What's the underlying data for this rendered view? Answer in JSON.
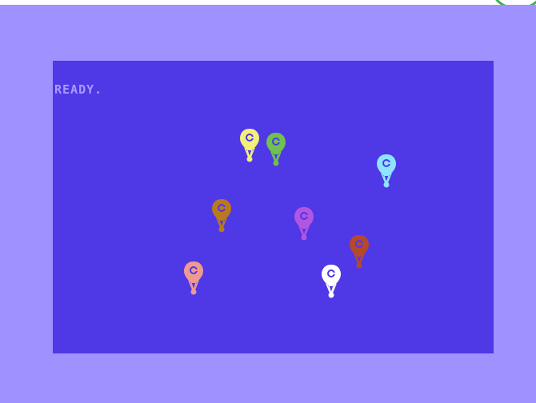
{
  "screen": {
    "status_text": "READY."
  },
  "colors": {
    "outer_border": "#9f91ff",
    "screen_background": "#4f38e6",
    "text": "#a99bff",
    "emblem_ring": "#3fae54"
  },
  "sprites": [
    {
      "name": "balloon-yellow",
      "color": "#f2f07a",
      "icon": "balloon-icon"
    },
    {
      "name": "balloon-green",
      "color": "#6fc24e",
      "icon": "balloon-icon"
    },
    {
      "name": "balloon-cyan",
      "color": "#8ee4ff",
      "icon": "balloon-icon"
    },
    {
      "name": "balloon-orange",
      "color": "#b9791d",
      "icon": "balloon-icon"
    },
    {
      "name": "balloon-purple",
      "color": "#b255e0",
      "icon": "balloon-icon"
    },
    {
      "name": "balloon-rust",
      "color": "#b4492d",
      "icon": "balloon-icon"
    },
    {
      "name": "balloon-salmon",
      "color": "#f09a8f",
      "icon": "balloon-icon"
    },
    {
      "name": "balloon-white",
      "color": "#ffffff",
      "icon": "balloon-icon"
    }
  ]
}
